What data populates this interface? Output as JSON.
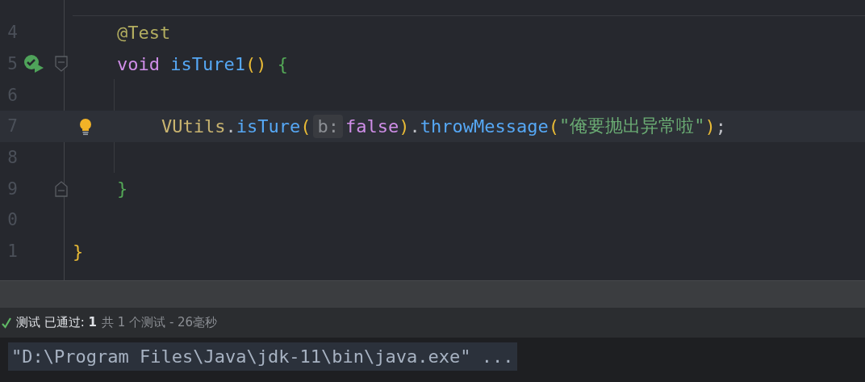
{
  "editor": {
    "class_body": [
      {
        "number": "4",
        "current": false,
        "tokens": [
          {
            "text": "@Test",
            "kind": "annotation"
          }
        ]
      },
      {
        "number": "5",
        "current": false,
        "gutter": [
          {
            "kind": "run"
          },
          {
            "kind": "fold_start"
          }
        ],
        "tokens": [
          {
            "text": "void",
            "kind": "keyword"
          },
          {
            "text": "isTure1",
            "kind": "method"
          },
          {
            "text": "()",
            "kind": "paren"
          },
          {
            "text": "{",
            "kind": "brace"
          }
        ],
        "children": [
          {
            "number": "6",
            "current": false
          },
          {
            "number": "7",
            "current": true,
            "gutter": [
              {
                "kind": "bulb"
              }
            ],
            "tokens": [
              {
                "text": "VUtils",
                "kind": "class"
              },
              {
                "text": ".",
                "kind": "punct"
              },
              {
                "text": "isTure",
                "kind": "method"
              },
              {
                "text": "(",
                "kind": "paren"
              },
              {
                "text": "b:",
                "kind": "hint"
              },
              {
                "text": "false",
                "kind": "literal"
              },
              {
                "text": ")",
                "kind": "paren"
              },
              {
                "text": ".",
                "kind": "punct"
              },
              {
                "text": "throwMessage",
                "kind": "method"
              },
              {
                "text": "(",
                "kind": "paren"
              },
              {
                "text": "\"俺要抛出异常啦\"",
                "kind": "string"
              },
              {
                "text": ")",
                "kind": "paren"
              },
              {
                "text": ";",
                "kind": "punct"
              }
            ]
          },
          {
            "number": "8",
            "current": false
          }
        ]
      },
      {
        "number": "9",
        "current": false,
        "gutter": [
          {
            "kind": "fold_end"
          }
        ],
        "tokens": [
          {
            "text": "}",
            "kind": "brace"
          }
        ]
      },
      {
        "number": "0",
        "current": false
      }
    ],
    "class_end": [
      {
        "number": "1",
        "current": false,
        "tokens": [
          {
            "text": "}",
            "kind": "paren"
          }
        ]
      }
    ]
  },
  "test_status": {
    "passed": true,
    "summary": "测试 已通过: **1**",
    "detail": "共 1 个测试 - 26毫秒"
  },
  "console": {
    "command": "\"D:\\Program Files\\Java\\jdk-11\\bin\\java.exe\" ..."
  }
}
